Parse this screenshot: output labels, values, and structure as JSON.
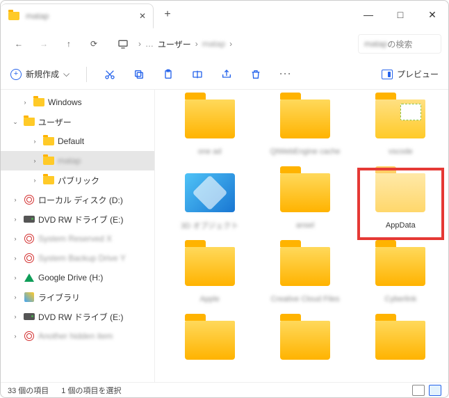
{
  "titlebar": {
    "tab_title": "matap",
    "close": "✕",
    "newtab": "+",
    "min": "—",
    "max": "□",
    "closewin": "✕"
  },
  "nav": {
    "back": "←",
    "forward": "→",
    "up": "↑",
    "refresh": "⟳",
    "pc": "⌂",
    "more": "…",
    "chev": "›"
  },
  "breadcrumbs": {
    "b0": "ユーザー",
    "b1": "matap"
  },
  "search": {
    "prefix": "matap",
    "suffix": "の検索"
  },
  "toolbar": {
    "new_label": "新規作成",
    "preview": "プレビュー",
    "dropdown": "⌵",
    "cut": "✂",
    "copy": "⧉",
    "paste": "📋",
    "rename": "A]",
    "share": "↗",
    "delete": "🗑",
    "more": "⋯"
  },
  "tree": [
    {
      "indent": 28,
      "exp": "›",
      "icon": "folder",
      "label": "Windows",
      "blur": false
    },
    {
      "indent": 14,
      "exp": "⌄",
      "icon": "folder",
      "label": "ユーザー",
      "blur": false
    },
    {
      "indent": 42,
      "exp": "›",
      "icon": "folder",
      "label": "Default",
      "blur": false
    },
    {
      "indent": 42,
      "exp": "›",
      "icon": "folder",
      "label": "matap",
      "blur": true,
      "sel": true
    },
    {
      "indent": 42,
      "exp": "›",
      "icon": "folder",
      "label": "パブリック",
      "blur": false
    },
    {
      "indent": 14,
      "exp": "›",
      "icon": "disc",
      "label": "ローカル ディスク (D:)",
      "blur": false
    },
    {
      "indent": 14,
      "exp": "›",
      "icon": "drive",
      "label": "DVD RW ドライブ (E:)",
      "blur": false
    },
    {
      "indent": 14,
      "exp": "›",
      "icon": "disc",
      "label": "System Reserved X",
      "blur": true
    },
    {
      "indent": 14,
      "exp": "›",
      "icon": "disc",
      "label": "System Backup Drive Y",
      "blur": true
    },
    {
      "indent": 14,
      "exp": "›",
      "icon": "gdrive",
      "label": "Google Drive (H:)",
      "blur": false
    },
    {
      "indent": 14,
      "exp": "›",
      "icon": "lib",
      "label": "ライブラリ",
      "blur": false
    },
    {
      "indent": 14,
      "exp": "›",
      "icon": "drive",
      "label": "DVD RW ドライブ (E:)",
      "blur": false
    },
    {
      "indent": 14,
      "exp": "›",
      "icon": "disc",
      "label": "Another hidden item",
      "blur": true
    }
  ],
  "folders": [
    {
      "icon": "fbig",
      "label": "one ad",
      "blur": true
    },
    {
      "icon": "fbig",
      "label": "QtWebEngine cache",
      "blur": true
    },
    {
      "icon": "fbig special",
      "label": "vscode",
      "blur": true
    },
    {
      "icon": "cube",
      "label": "3D オブジェクト",
      "blur": true
    },
    {
      "icon": "fbig",
      "label": "ansel",
      "blur": true
    },
    {
      "icon": "fbig light",
      "label": "AppData",
      "blur": false,
      "highlight": true
    },
    {
      "icon": "fbig",
      "label": "Apple",
      "blur": true
    },
    {
      "icon": "fbig",
      "label": "Creative Cloud Files",
      "blur": true
    },
    {
      "icon": "fbig",
      "label": "Cyberlink",
      "blur": true
    },
    {
      "icon": "fbig",
      "label": "",
      "blur": true
    },
    {
      "icon": "fbig",
      "label": "",
      "blur": true
    },
    {
      "icon": "fbig",
      "label": "",
      "blur": true
    }
  ],
  "status": {
    "count": "33 個の項目",
    "sel": "1 個の項目を選択"
  }
}
